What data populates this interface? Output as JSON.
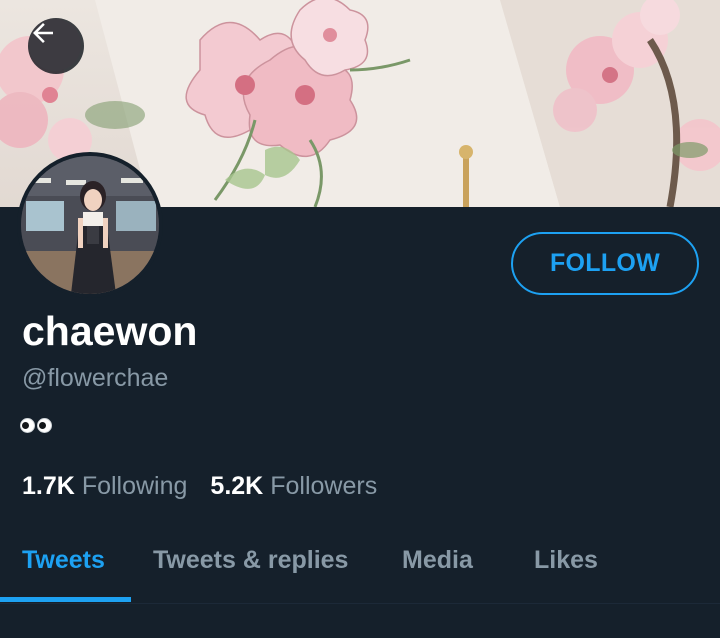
{
  "profile": {
    "name": "chaewon",
    "handle": "@flowerchae",
    "bio_emoji": "eyes-emoji"
  },
  "stats": {
    "following_count": "1.7K",
    "following_label": "Following",
    "followers_count": "5.2K",
    "followers_label": "Followers"
  },
  "actions": {
    "follow_label": "FOLLOW"
  },
  "tabs": [
    {
      "label": "Tweets",
      "active": true
    },
    {
      "label": "Tweets & replies",
      "active": false
    },
    {
      "label": "Media",
      "active": false
    },
    {
      "label": "Likes",
      "active": false
    }
  ],
  "icons": {
    "back": "arrow-left-icon"
  },
  "colors": {
    "background": "#15202b",
    "accent": "#1da1f2",
    "secondary_text": "#8899a6",
    "primary_text": "#ffffff"
  }
}
